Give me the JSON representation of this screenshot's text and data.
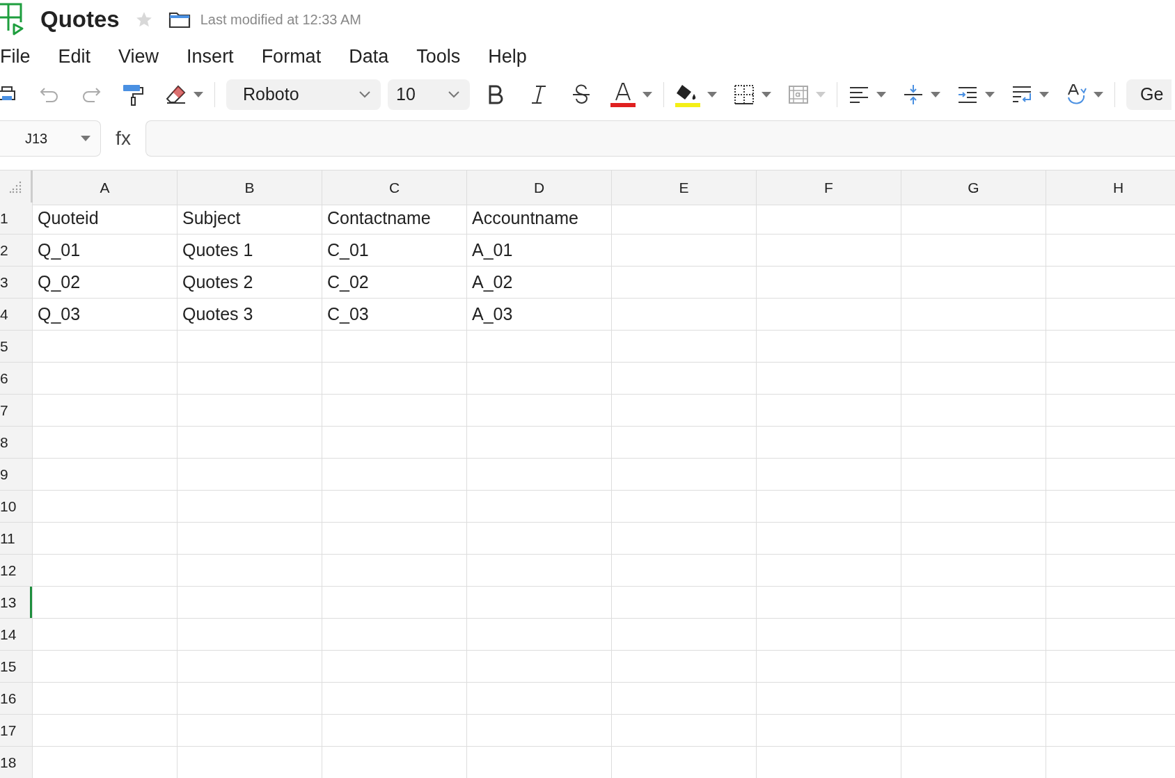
{
  "app": {
    "title": "Quotes",
    "starred": false,
    "last_modified": "Last modified at 12:33 AM"
  },
  "menu": [
    "File",
    "Edit",
    "View",
    "Insert",
    "Format",
    "Data",
    "Tools",
    "Help"
  ],
  "toolbar": {
    "font": "Roboto",
    "font_size": "10",
    "next_button": "Ge"
  },
  "formula_bar": {
    "name_box": "J13",
    "label": "fx"
  },
  "columns": [
    "A",
    "B",
    "C",
    "D",
    "E",
    "F",
    "G",
    "H"
  ],
  "rows": [
    {
      "number": "1",
      "selected": false,
      "cells": [
        "Quoteid",
        "Subject",
        "Contactname",
        "Accountname"
      ]
    },
    {
      "number": "2",
      "selected": false,
      "cells": [
        "Q_01",
        "Quotes 1",
        "C_01",
        "A_01"
      ]
    },
    {
      "number": "3",
      "selected": false,
      "cells": [
        "Q_02",
        "Quotes 2",
        "C_02",
        "A_02"
      ]
    },
    {
      "number": "4",
      "selected": false,
      "cells": [
        "Q_03",
        "Quotes 3",
        "C_03",
        "A_03"
      ]
    },
    {
      "number": "5",
      "selected": false,
      "cells": []
    },
    {
      "number": "6",
      "selected": false,
      "cells": []
    },
    {
      "number": "7",
      "selected": false,
      "cells": []
    },
    {
      "number": "8",
      "selected": false,
      "cells": []
    },
    {
      "number": "9",
      "selected": false,
      "cells": []
    },
    {
      "number": "10",
      "selected": false,
      "cells": []
    },
    {
      "number": "11",
      "selected": false,
      "cells": []
    },
    {
      "number": "12",
      "selected": false,
      "cells": []
    },
    {
      "number": "13",
      "selected": true,
      "cells": []
    },
    {
      "number": "14",
      "selected": false,
      "cells": []
    },
    {
      "number": "15",
      "selected": false,
      "cells": []
    },
    {
      "number": "16",
      "selected": false,
      "cells": []
    },
    {
      "number": "17",
      "selected": false,
      "cells": []
    },
    {
      "number": "18",
      "selected": false,
      "cells": []
    }
  ]
}
